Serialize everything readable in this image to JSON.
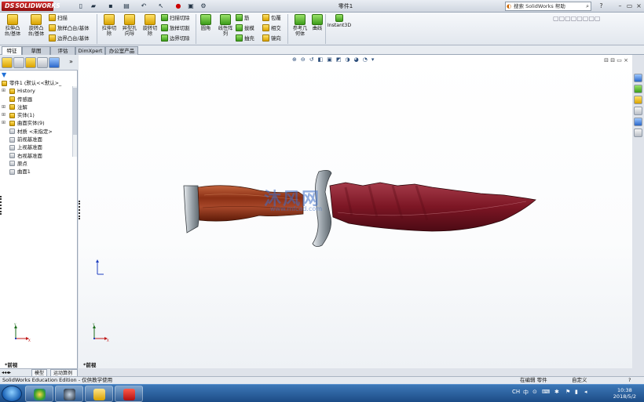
{
  "app": {
    "logo": "SOLIDWORKS",
    "document_title": "零件1",
    "help_search_placeholder": "搜索 SolidWorks 帮助"
  },
  "ribbon": {
    "extrude_boss": "拉伸凸\n台/基体",
    "revolve_boss": "旋转凸\n台/基体",
    "sweep": "扫描",
    "loft_boss": "放样凸台/基体",
    "boundary_boss": "边界凸台/基体",
    "extrude_cut": "拉伸切\n除",
    "hole_wizard": "异型孔\n向导",
    "revolve_cut": "旋转切\n除",
    "sweep_cut": "扫描切除",
    "loft_cut": "放样切割",
    "boundary_cut": "边界切除",
    "fillet": "圆角",
    "linear_pattern": "线性阵\n列",
    "rib": "筋",
    "draft": "拔模",
    "shell": "抽壳",
    "wrap": "包覆",
    "intersect": "相交",
    "mirror": "镜向",
    "reference_geometry": "参考几\n何体",
    "curves": "曲线",
    "instant3d": "Instant3D"
  },
  "command_tabs": [
    "特征",
    "草图",
    "评估",
    "DimXpert",
    "办公室产品"
  ],
  "feature_tree": [
    {
      "label": "零件1 (默认<<默认>_",
      "icon": "part-icon"
    },
    {
      "label": "History",
      "icon": "history-icon"
    },
    {
      "label": "传感器",
      "icon": "sensor-icon"
    },
    {
      "label": "注解",
      "icon": "annotation-icon"
    },
    {
      "label": "实体(1)",
      "icon": "solid-body-icon"
    },
    {
      "label": "曲面实体(9)",
      "icon": "surface-body-icon"
    },
    {
      "label": "材质 <未指定>",
      "icon": "material-icon"
    },
    {
      "label": "前视基准面",
      "icon": "plane-icon"
    },
    {
      "label": "上视基准面",
      "icon": "plane-icon"
    },
    {
      "label": "右视基准面",
      "icon": "plane-icon"
    },
    {
      "label": "原点",
      "icon": "origin-icon"
    },
    {
      "label": "曲面1",
      "icon": "surface-icon"
    }
  ],
  "viewport": {
    "view_label_left": "*前视",
    "view_label_main": "*前视",
    "watermark_name": "沐风网",
    "watermark_url": "www.mfcad.com"
  },
  "bottom_tabs": [
    "模型",
    "运动算例1"
  ],
  "status": {
    "left": "SolidWorks Education Edition - 仅供教学使用",
    "mode": "在编辑 零件",
    "units": "自定义"
  },
  "taskbar": {
    "time": "10:38",
    "date": "2018/5/2",
    "lang": "CH"
  },
  "colors": {
    "ribbon_bg": "#e2e7ee",
    "viewport_bg": "#ffffff",
    "taskbar": "#1c4c86",
    "handle_wood": "#8a2f14",
    "blade": "#8a1f2a"
  }
}
